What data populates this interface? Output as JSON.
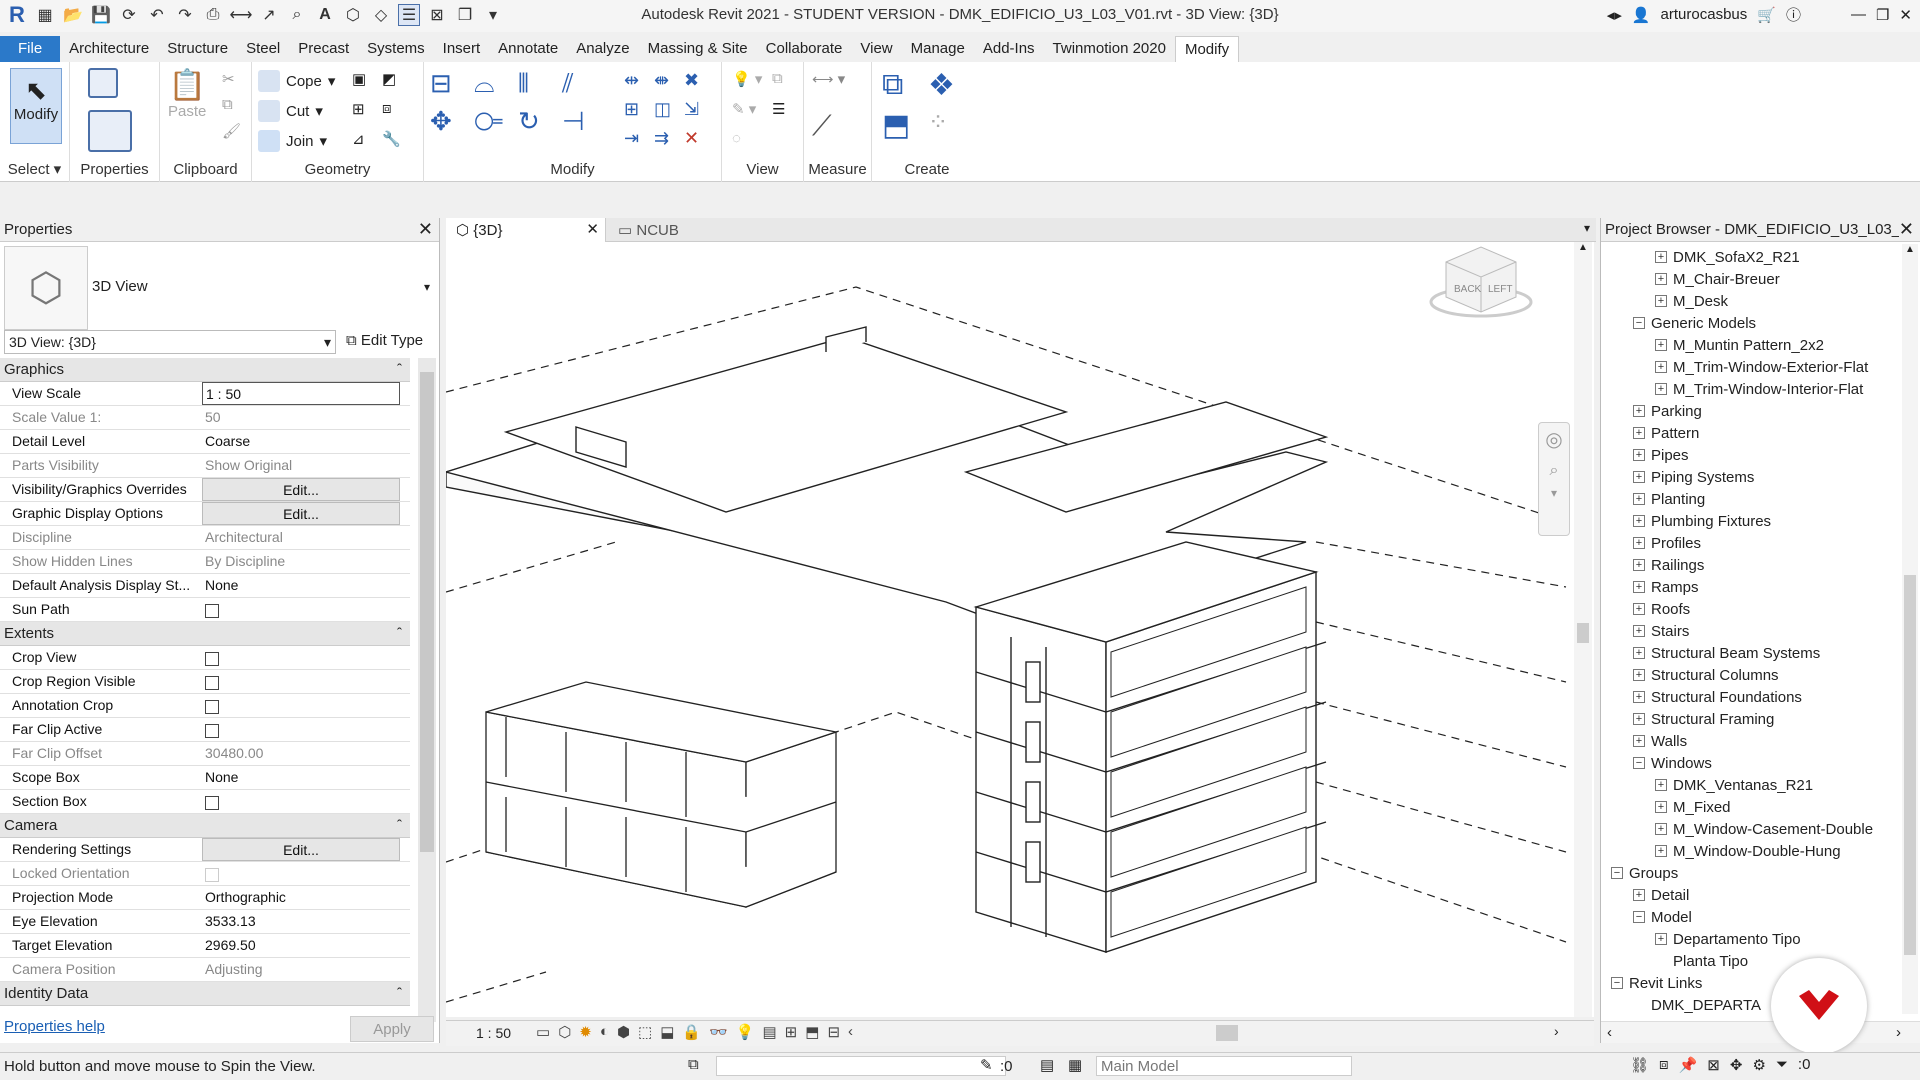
{
  "title": "Autodesk Revit 2021 - STUDENT VERSION - DMK_EDIFICIO_U3_L03_V01.rvt - 3D View: {3D}",
  "user": "arturocasbus",
  "ribbon_tabs": [
    "File",
    "Architecture",
    "Structure",
    "Steel",
    "Precast",
    "Systems",
    "Insert",
    "Annotate",
    "Analyze",
    "Massing & Site",
    "Collaborate",
    "View",
    "Manage",
    "Add-Ins",
    "Twinmotion 2020",
    "Modify"
  ],
  "ribbon": {
    "modify_label": "Modify",
    "select_label": "Select",
    "properties_label": "Properties",
    "paste_label": "Paste",
    "clipboard_label": "Clipboard",
    "cope_label": "Cope",
    "cut_label": "Cut",
    "join_label": "Join",
    "geometry_label": "Geometry",
    "modify_group_label": "Modify",
    "view_label": "View",
    "measure_label": "Measure",
    "create_label": "Create"
  },
  "properties": {
    "header": "Properties",
    "type_name": "3D View",
    "instance_selector": "3D View: {3D}",
    "edit_type": "Edit Type",
    "categories": {
      "graphics": "Graphics",
      "extents": "Extents",
      "camera": "Camera",
      "identity": "Identity Data"
    },
    "rows": {
      "view_scale": [
        "View Scale",
        "1 : 50"
      ],
      "scale_value": [
        "Scale Value    1:",
        "50"
      ],
      "detail_level": [
        "Detail Level",
        "Coarse"
      ],
      "parts_visibility": [
        "Parts Visibility",
        "Show Original"
      ],
      "vg_overrides": [
        "Visibility/Graphics Overrides",
        "Edit..."
      ],
      "graphic_display": [
        "Graphic Display Options",
        "Edit..."
      ],
      "discipline": [
        "Discipline",
        "Architectural"
      ],
      "hidden_lines": [
        "Show Hidden Lines",
        "By Discipline"
      ],
      "analysis_display": [
        "Default Analysis Display St...",
        "None"
      ],
      "sun_path": [
        "Sun Path",
        ""
      ],
      "crop_view": [
        "Crop View",
        ""
      ],
      "crop_region": [
        "Crop Region Visible",
        ""
      ],
      "annotation_crop": [
        "Annotation Crop",
        ""
      ],
      "far_clip_active": [
        "Far Clip Active",
        ""
      ],
      "far_clip_offset": [
        "Far Clip Offset",
        "30480.00"
      ],
      "scope_box": [
        "Scope Box",
        "None"
      ],
      "section_box": [
        "Section Box",
        ""
      ],
      "rendering": [
        "Rendering Settings",
        "Edit..."
      ],
      "locked_orientation": [
        "Locked Orientation",
        ""
      ],
      "projection": [
        "Projection Mode",
        "Orthographic"
      ],
      "eye_elevation": [
        "Eye Elevation",
        "3533.13"
      ],
      "target_elevation": [
        "Target Elevation",
        "2969.50"
      ],
      "camera_position": [
        "Camera Position",
        "Adjusting"
      ]
    },
    "help_link": "Properties help",
    "apply": "Apply"
  },
  "view_tabs": [
    "{3D}",
    "NCUB"
  ],
  "view_scale": "1 : 50",
  "browser": {
    "header": "Project Browser - DMK_EDIFICIO_U3_L03_...",
    "items": [
      {
        "label": "DMK_SofaX2_R21",
        "indent": 2,
        "toggle": "+"
      },
      {
        "label": "M_Chair-Breuer",
        "indent": 2,
        "toggle": "+"
      },
      {
        "label": "M_Desk",
        "indent": 2,
        "toggle": "+"
      },
      {
        "label": "Generic Models",
        "indent": 1,
        "toggle": "-"
      },
      {
        "label": "M_Muntin Pattern_2x2",
        "indent": 2,
        "toggle": "+"
      },
      {
        "label": "M_Trim-Window-Exterior-Flat",
        "indent": 2,
        "toggle": "+"
      },
      {
        "label": "M_Trim-Window-Interior-Flat",
        "indent": 2,
        "toggle": "+"
      },
      {
        "label": "Parking",
        "indent": 1,
        "toggle": "+"
      },
      {
        "label": "Pattern",
        "indent": 1,
        "toggle": "+"
      },
      {
        "label": "Pipes",
        "indent": 1,
        "toggle": "+"
      },
      {
        "label": "Piping Systems",
        "indent": 1,
        "toggle": "+"
      },
      {
        "label": "Planting",
        "indent": 1,
        "toggle": "+"
      },
      {
        "label": "Plumbing Fixtures",
        "indent": 1,
        "toggle": "+"
      },
      {
        "label": "Profiles",
        "indent": 1,
        "toggle": "+"
      },
      {
        "label": "Railings",
        "indent": 1,
        "toggle": "+"
      },
      {
        "label": "Ramps",
        "indent": 1,
        "toggle": "+"
      },
      {
        "label": "Roofs",
        "indent": 1,
        "toggle": "+"
      },
      {
        "label": "Stairs",
        "indent": 1,
        "toggle": "+"
      },
      {
        "label": "Structural Beam Systems",
        "indent": 1,
        "toggle": "+"
      },
      {
        "label": "Structural Columns",
        "indent": 1,
        "toggle": "+"
      },
      {
        "label": "Structural Foundations",
        "indent": 1,
        "toggle": "+"
      },
      {
        "label": "Structural Framing",
        "indent": 1,
        "toggle": "+"
      },
      {
        "label": "Walls",
        "indent": 1,
        "toggle": "+"
      },
      {
        "label": "Windows",
        "indent": 1,
        "toggle": "-"
      },
      {
        "label": "DMK_Ventanas_R21",
        "indent": 2,
        "toggle": "+"
      },
      {
        "label": "M_Fixed",
        "indent": 2,
        "toggle": "+"
      },
      {
        "label": "M_Window-Casement-Double",
        "indent": 2,
        "toggle": "+"
      },
      {
        "label": "M_Window-Double-Hung",
        "indent": 2,
        "toggle": "+"
      },
      {
        "label": "Groups",
        "indent": 0,
        "toggle": "-"
      },
      {
        "label": "Detail",
        "indent": 1,
        "toggle": "+"
      },
      {
        "label": "Model",
        "indent": 1,
        "toggle": "-"
      },
      {
        "label": "Departamento Tipo",
        "indent": 2,
        "toggle": "+"
      },
      {
        "label": "Planta Tipo",
        "indent": 2,
        "toggle": ""
      },
      {
        "label": "Revit Links",
        "indent": 0,
        "toggle": "-"
      },
      {
        "label": "DMK_DEPARTA",
        "indent": 1,
        "toggle": ""
      }
    ]
  },
  "status": {
    "message": "Hold button and move mouse to Spin the View.",
    "selection_count": ":0",
    "model": "Main Model",
    "filter_count": ":0"
  },
  "viewcube": {
    "back": "BACK",
    "left": "LEFT"
  }
}
